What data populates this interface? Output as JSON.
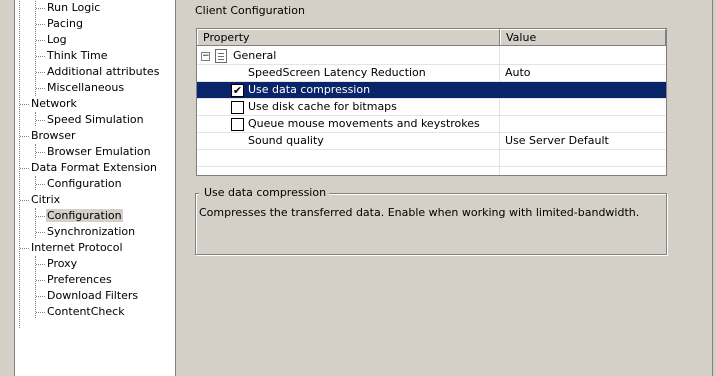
{
  "tree": {
    "items": [
      {
        "label": "Run Logic",
        "level": 2
      },
      {
        "label": "Pacing",
        "level": 2
      },
      {
        "label": "Log",
        "level": 2
      },
      {
        "label": "Think Time",
        "level": 2
      },
      {
        "label": "Additional attributes",
        "level": 2
      },
      {
        "label": "Miscellaneous",
        "level": 2
      },
      {
        "label": "Network",
        "level": 1
      },
      {
        "label": "Speed Simulation",
        "level": 2
      },
      {
        "label": "Browser",
        "level": 1
      },
      {
        "label": "Browser Emulation",
        "level": 2
      },
      {
        "label": "Data Format Extension",
        "level": 1
      },
      {
        "label": "Configuration",
        "level": 2
      },
      {
        "label": "Citrix",
        "level": 1
      },
      {
        "label": "Configuration",
        "level": 2,
        "selected": true
      },
      {
        "label": "Synchronization",
        "level": 2
      },
      {
        "label": "Internet Protocol",
        "level": 1
      },
      {
        "label": "Proxy",
        "level": 2
      },
      {
        "label": "Preferences",
        "level": 2
      },
      {
        "label": "Download Filters",
        "level": 2
      },
      {
        "label": "ContentCheck",
        "level": 2
      }
    ]
  },
  "panel": {
    "title": "Client Configuration"
  },
  "grid": {
    "headers": {
      "property": "Property",
      "value": "Value"
    },
    "group": {
      "label": "General",
      "expander": "−"
    },
    "rows": [
      {
        "label": "SpeedScreen Latency Reduction",
        "value": "Auto",
        "checkbox": false
      },
      {
        "label": "Use data compression",
        "value": "",
        "checkbox": true,
        "checked": true,
        "selected": true
      },
      {
        "label": "Use disk cache for bitmaps",
        "value": "",
        "checkbox": true,
        "checked": false
      },
      {
        "label": "Queue mouse movements and keystrokes",
        "value": "",
        "checkbox": true,
        "checked": false
      },
      {
        "label": "Sound quality",
        "value": "Use Server Default",
        "checkbox": false
      }
    ]
  },
  "description": {
    "title": "Use data compression",
    "text": "Compresses the transferred data. Enable when working with limited-bandwidth."
  },
  "colors": {
    "selection": "#0a246a",
    "window": "#d4d0c8"
  }
}
